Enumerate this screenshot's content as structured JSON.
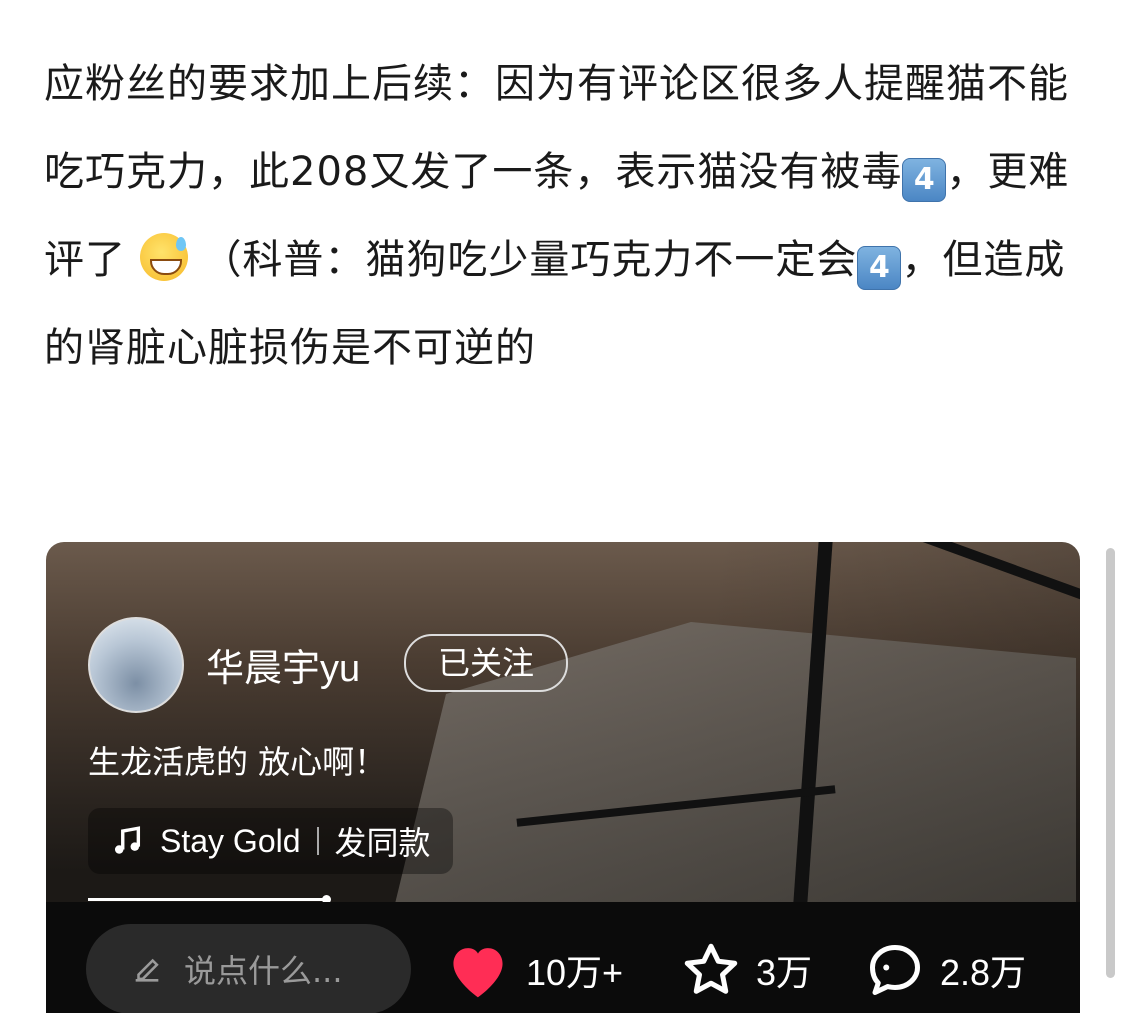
{
  "article": {
    "text_part1": "应粉丝的要求加上后续：因为有评论区很多人提醒猫不能吃巧克力，此208又发了一条，表示猫没有被毒",
    "text_part2": "，更难评了",
    "text_part3": "（科普：猫狗吃少量巧克力不一定会",
    "text_part4": "，但造成的肾脏心脏损伤是不可逆的",
    "keycap": "4"
  },
  "video_card": {
    "username": "华晨宇yu",
    "follow_label": "已关注",
    "caption": "生龙活虎的 放心啊！",
    "music_title": "Stay Gold",
    "music_action": "发同款",
    "comment_placeholder": "说点什么...",
    "likes": "10万+",
    "favorites": "3万",
    "comments": "2.8万",
    "progress_fraction": 0.25
  }
}
